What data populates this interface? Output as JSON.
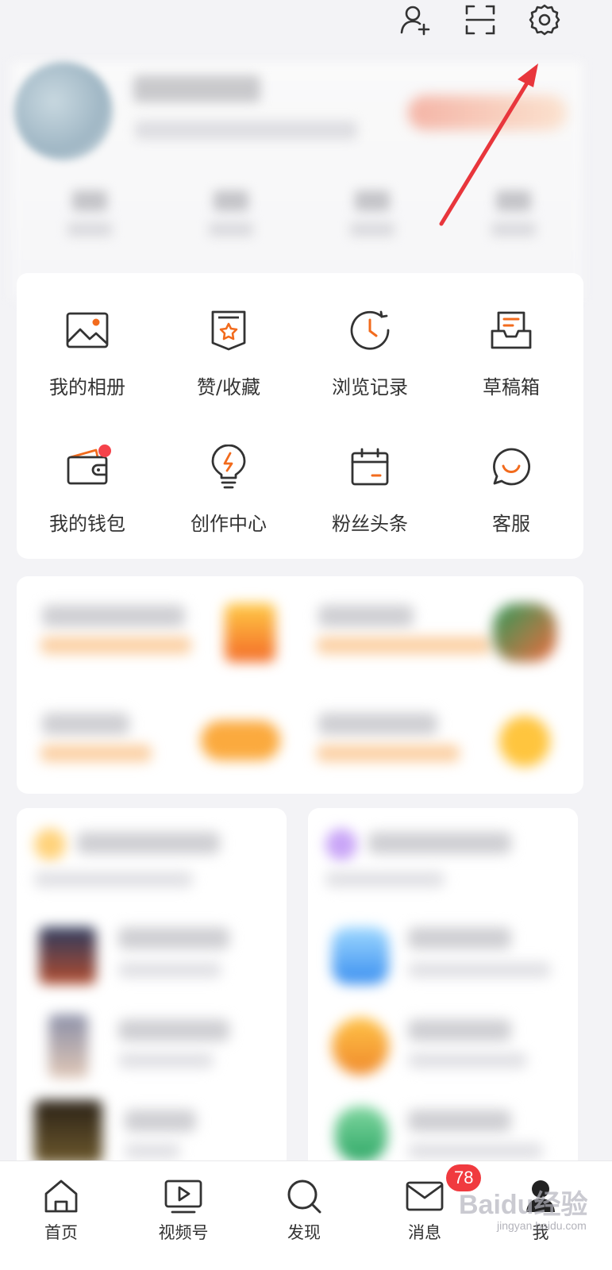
{
  "menu": {
    "row1": [
      {
        "label": "我的相册",
        "icon": "photo-album-icon"
      },
      {
        "label": "赞/收藏",
        "icon": "bookmark-star-icon"
      },
      {
        "label": "浏览记录",
        "icon": "history-clock-icon"
      },
      {
        "label": "草稿箱",
        "icon": "draft-tray-icon"
      }
    ],
    "row2": [
      {
        "label": "我的钱包",
        "icon": "wallet-icon"
      },
      {
        "label": "创作中心",
        "icon": "lightbulb-icon"
      },
      {
        "label": "粉丝头条",
        "icon": "calendar-icon"
      },
      {
        "label": "客服",
        "icon": "chat-smile-icon"
      }
    ]
  },
  "bottom_nav": {
    "tabs": [
      {
        "label": "首页",
        "icon": "home-icon"
      },
      {
        "label": "视频号",
        "icon": "video-play-icon"
      },
      {
        "label": "发现",
        "icon": "search-icon"
      },
      {
        "label": "消息",
        "icon": "mail-icon"
      },
      {
        "label": "我",
        "icon": "user-icon"
      }
    ],
    "message_badge": "78"
  },
  "top_icons": [
    "add-friend-icon",
    "scan-icon",
    "settings-gear-icon"
  ],
  "watermark": {
    "main": "Baidu经验",
    "sub": "jingyan.baidu.com"
  },
  "colors": {
    "accent": "#f26b1d",
    "annotation_arrow": "#e8363c",
    "badge": "#f03a3f"
  }
}
